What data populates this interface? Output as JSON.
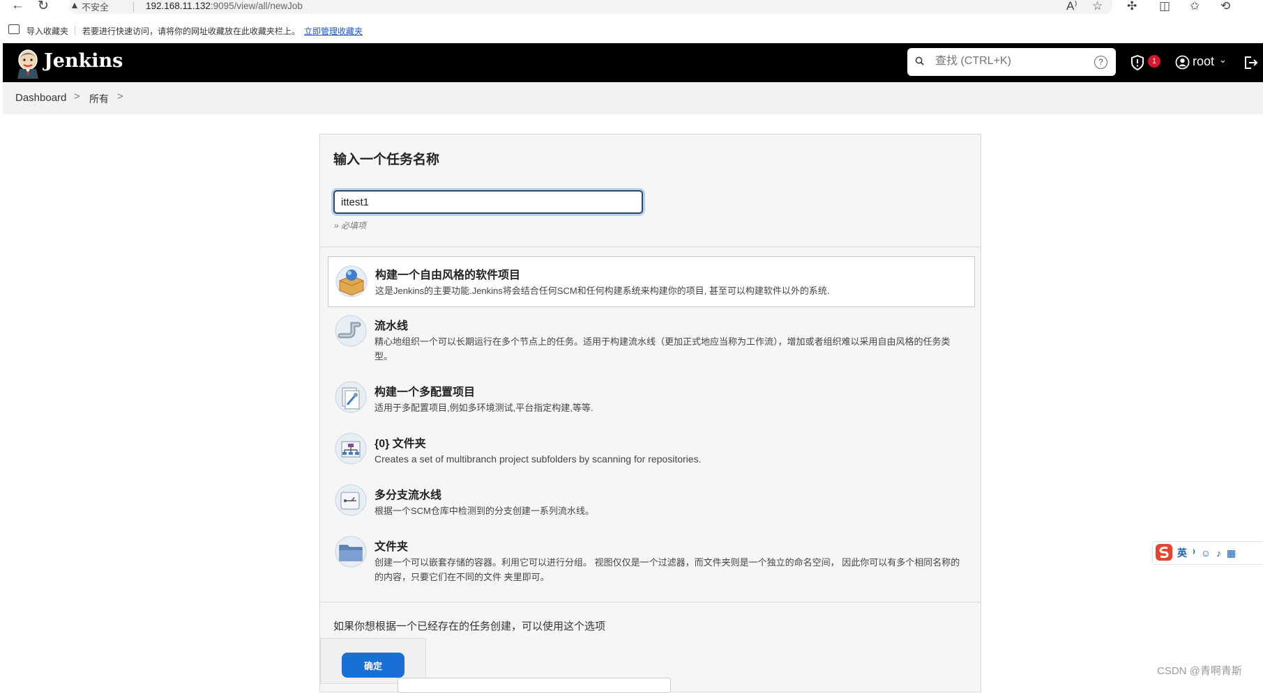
{
  "browser": {
    "security_label": "不安全",
    "url_host": "192.168.11.132",
    "url_path": ":9095/view/all/newJob"
  },
  "favorites_bar": {
    "import_label": "导入收藏夹",
    "hint_text": "若要进行快速访问，请将你的网址收藏放在此收藏夹栏上。",
    "manage_link": "立即管理收藏夹"
  },
  "header": {
    "brand": "Jenkins",
    "search_placeholder": "查找 (CTRL+K)",
    "search_help": "?",
    "security_badge_count": "1",
    "user_name": "root"
  },
  "breadcrumb": {
    "items": [
      "Dashboard",
      "所有"
    ],
    "separator": ">"
  },
  "form": {
    "title": "输入一个任务名称",
    "item_name_value": "ittest1",
    "required_hint": "» 必填项"
  },
  "job_types": [
    {
      "name": "构建一个自由风格的软件项目",
      "desc": "这是Jenkins的主要功能.Jenkins将会结合任何SCM和任何构建系统来构建你的项目, 甚至可以构建软件以外的系统.",
      "icon": "freestyle-package-icon",
      "selected": true
    },
    {
      "name": "流水线",
      "desc": "精心地组织一个可以长期运行在多个节点上的任务。适用于构建流水线（更加正式地应当称为工作流），增加或者组织难以采用自由风格的任务类型。",
      "icon": "pipeline-icon",
      "selected": false
    },
    {
      "name": "构建一个多配置项目",
      "desc": "适用于多配置项目,例如多环境测试,平台指定构建,等等.",
      "icon": "multi-config-icon",
      "selected": false
    },
    {
      "name": "{0} 文件夹",
      "desc": "Creates a set of multibranch project subfolders by scanning for repositories.",
      "icon": "org-folder-icon",
      "selected": false
    },
    {
      "name": "多分支流水线",
      "desc": "根据一个SCM仓库中检测到的分支创建一系列流水线。",
      "icon": "multibranch-pipeline-icon",
      "selected": false
    },
    {
      "name": "文件夹",
      "desc": "创建一个可以嵌套存储的容器。利用它可以进行分组。 视图仅仅是一个过滤器，而文件夹则是一个独立的命名空间， 因此你可以有多个相同名称的的内容，只要它们在不同的文件 夹里即可。",
      "icon": "folder-icon",
      "selected": false
    }
  ],
  "copy_section": {
    "hint": "如果你想根据一个已经存在的任务创建，可以使用这个选项"
  },
  "ok_button": "确定",
  "ime_toolbar": {
    "items": "英 ⁾ ☺ ♪ ▦"
  },
  "watermark": "CSDN @青啊青斯",
  "colors": {
    "header_bg": "#000000",
    "accent": "#1a6fd6",
    "badge": "#d6172d",
    "panel_bg": "#f6f6f7"
  }
}
